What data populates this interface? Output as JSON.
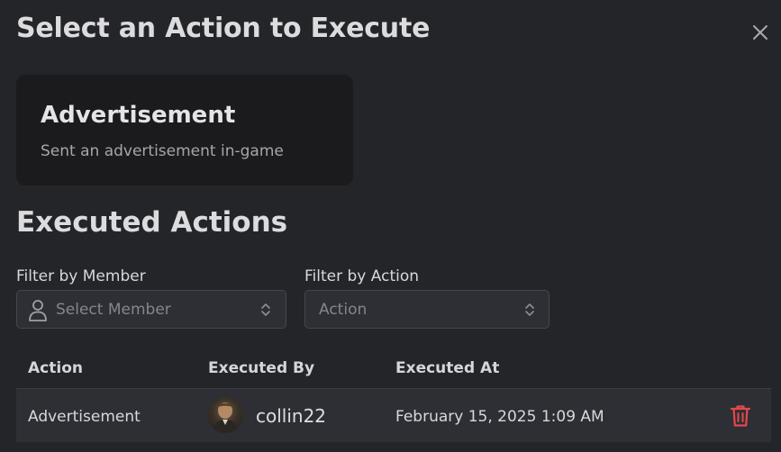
{
  "modal": {
    "title": "Select an Action to Execute",
    "close_icon": "close-icon"
  },
  "action_card": {
    "title": "Advertisement",
    "description": "Sent an advertisement in-game"
  },
  "executed": {
    "title": "Executed Actions",
    "filter_member": {
      "label": "Filter by Member",
      "placeholder": "Select Member",
      "icon": "user-icon"
    },
    "filter_action": {
      "label": "Filter by Action",
      "placeholder": "Action"
    },
    "table": {
      "headers": [
        "Action",
        "Executed By",
        "Executed At"
      ],
      "rows": [
        {
          "action": "Advertisement",
          "executed_by": "collin22",
          "executed_at": "February 15, 2025 1:09 AM",
          "delete_icon": "trash-icon"
        }
      ]
    }
  },
  "colors": {
    "background": "#242529",
    "card": "#1b1b1e",
    "input": "#2e2f34",
    "danger": "#e5484d"
  }
}
